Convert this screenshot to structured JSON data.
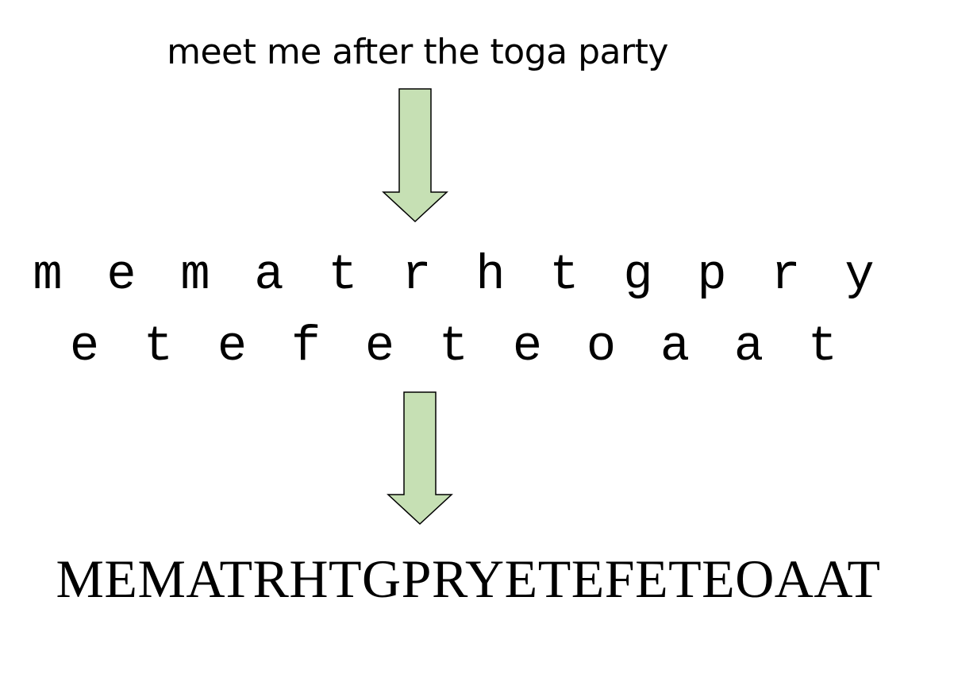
{
  "plaintext": "meet me after the toga party",
  "rails": [
    [
      "m",
      "e",
      "m",
      "a",
      "t",
      "r",
      "h",
      "t",
      "g",
      "p",
      "r",
      "y"
    ],
    [
      "e",
      "t",
      "e",
      "f",
      "e",
      "t",
      "e",
      "o",
      "a",
      "a",
      "t"
    ]
  ],
  "ciphertext": "MEMATRHTGPRYETEFETEOAAT",
  "colors": {
    "arrow_fill": "#c6e0b4",
    "arrow_stroke": "#000000"
  },
  "icons": {
    "arrow_1": "down-arrow-icon",
    "arrow_2": "down-arrow-icon"
  }
}
